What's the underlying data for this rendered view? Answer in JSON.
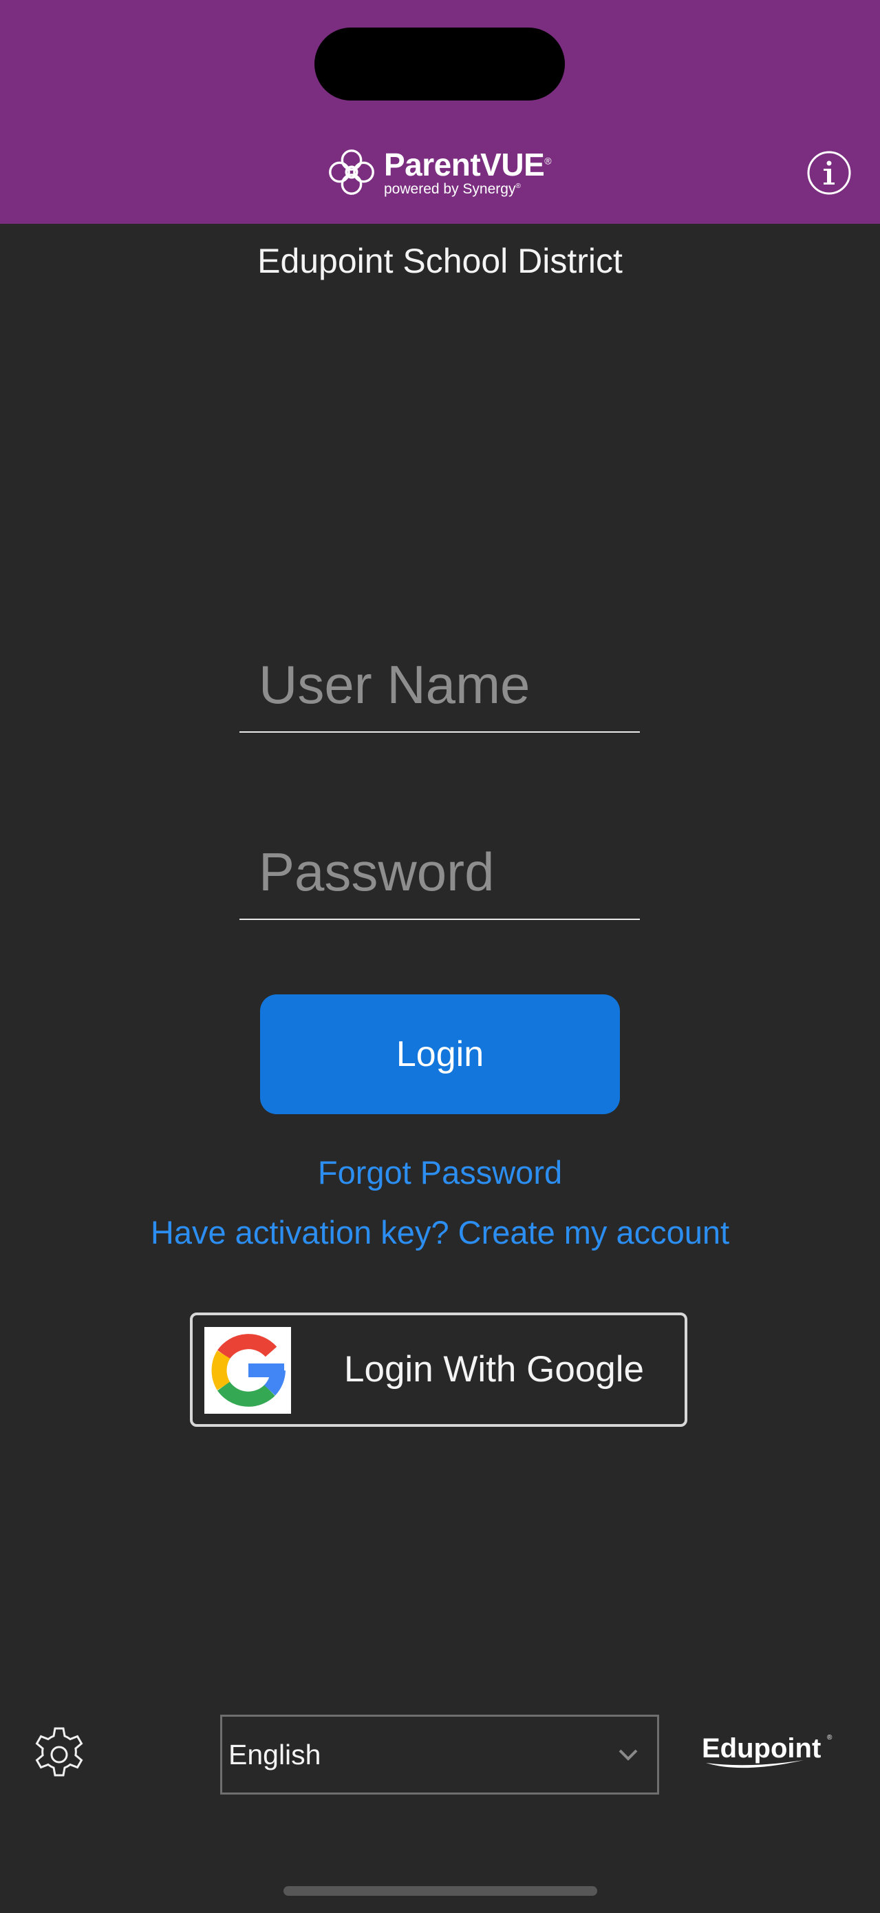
{
  "header": {
    "brand_name": "ParentVUE",
    "brand_tagline": "powered by Synergy",
    "background": "#7b2e80"
  },
  "district_name": "Edupoint School District",
  "login_form": {
    "username_placeholder": "User Name",
    "password_placeholder": "Password",
    "login_label": "Login",
    "forgot_password": "Forgot Password",
    "activation_link": "Have activation key? Create my account",
    "google_login_label": "Login With Google"
  },
  "footer": {
    "language_value": "English",
    "vendor_logo_text": "Edupoint"
  },
  "colors": {
    "background": "#282828",
    "accent": "#1276dc",
    "link": "#2b8ef0"
  },
  "icons": [
    "parentvue-logo-icon",
    "info-icon",
    "google-icon",
    "gear-icon",
    "chevron-down-icon",
    "edupoint-logo"
  ]
}
